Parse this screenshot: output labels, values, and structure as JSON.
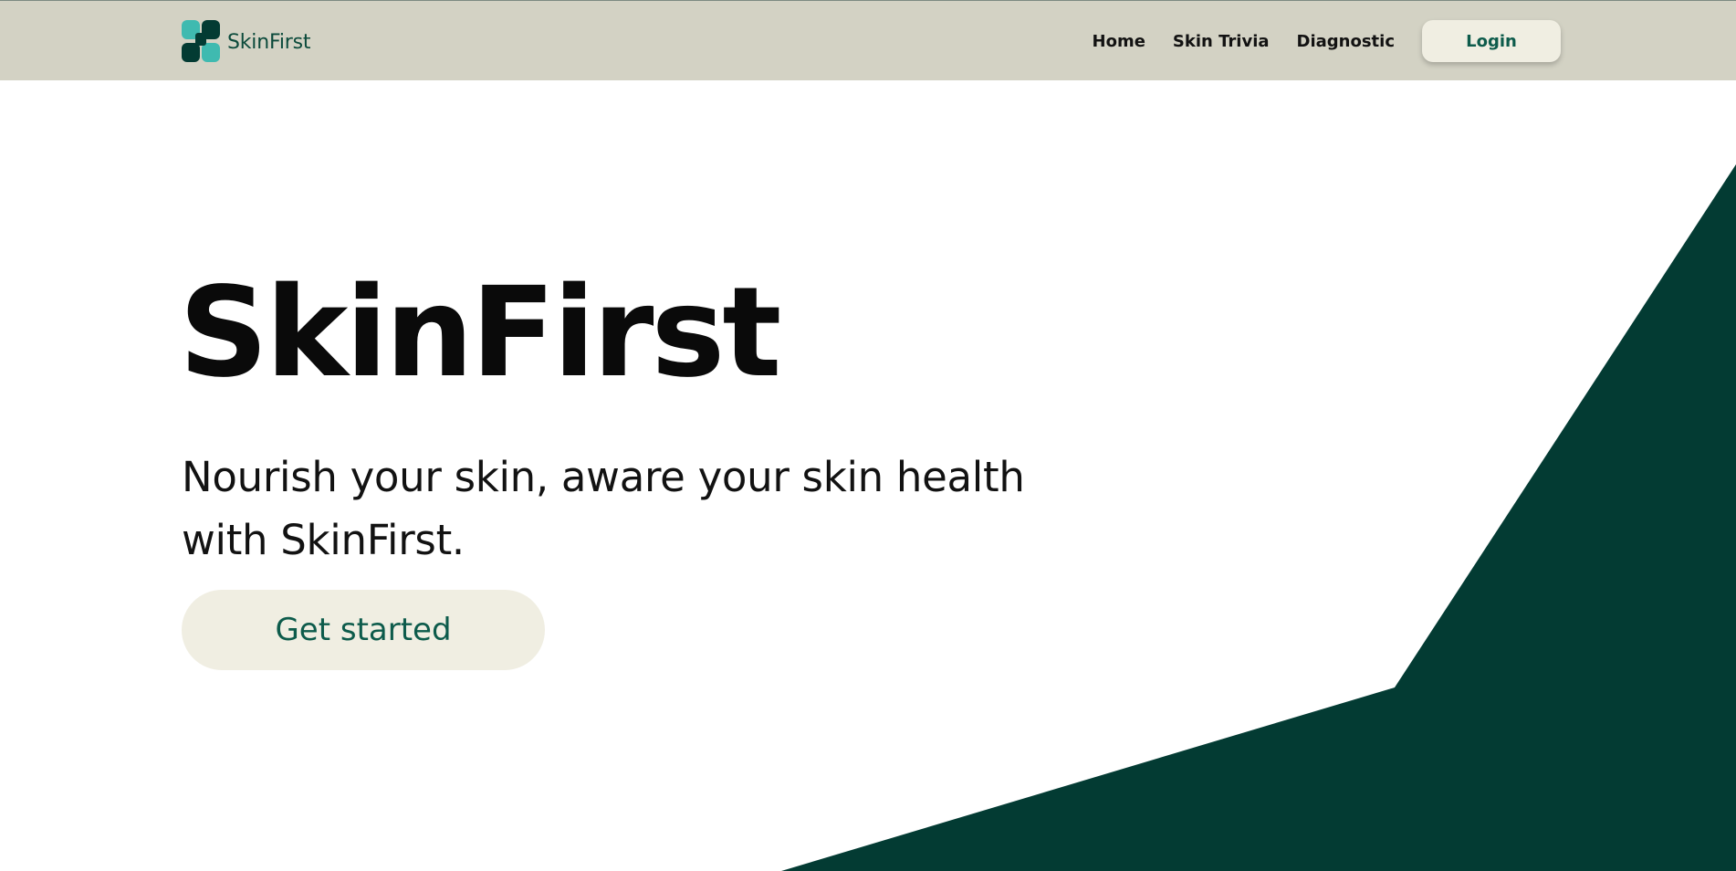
{
  "brand": {
    "name": "SkinFirst",
    "logo_icon": "skinfirst-logo-icon"
  },
  "nav": {
    "links": [
      "Home",
      "Skin Trivia",
      "Diagnostic"
    ],
    "login_label": "Login"
  },
  "hero": {
    "title": "SkinFirst",
    "subtitle": "Nourish your skin, aware your skin health with SkinFirst.",
    "cta_label": "Get started"
  },
  "colors": {
    "nav_background": "#d3d2c4",
    "brand_dark_green": "#033b33",
    "brand_teal": "#3fbab0",
    "button_background": "#f0eee2",
    "button_text": "#0d5b4b"
  }
}
